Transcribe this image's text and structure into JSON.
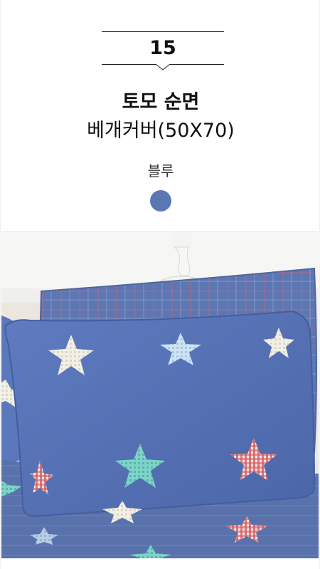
{
  "option": {
    "number": "15",
    "title_line1": "토모 순면",
    "title_line2": "베개커버(50X70)",
    "color_name": "블루",
    "swatch_color": "#5a77b4"
  },
  "photo": {
    "subject": "blue pillowcase with star pattern",
    "icon": "product-photo"
  }
}
